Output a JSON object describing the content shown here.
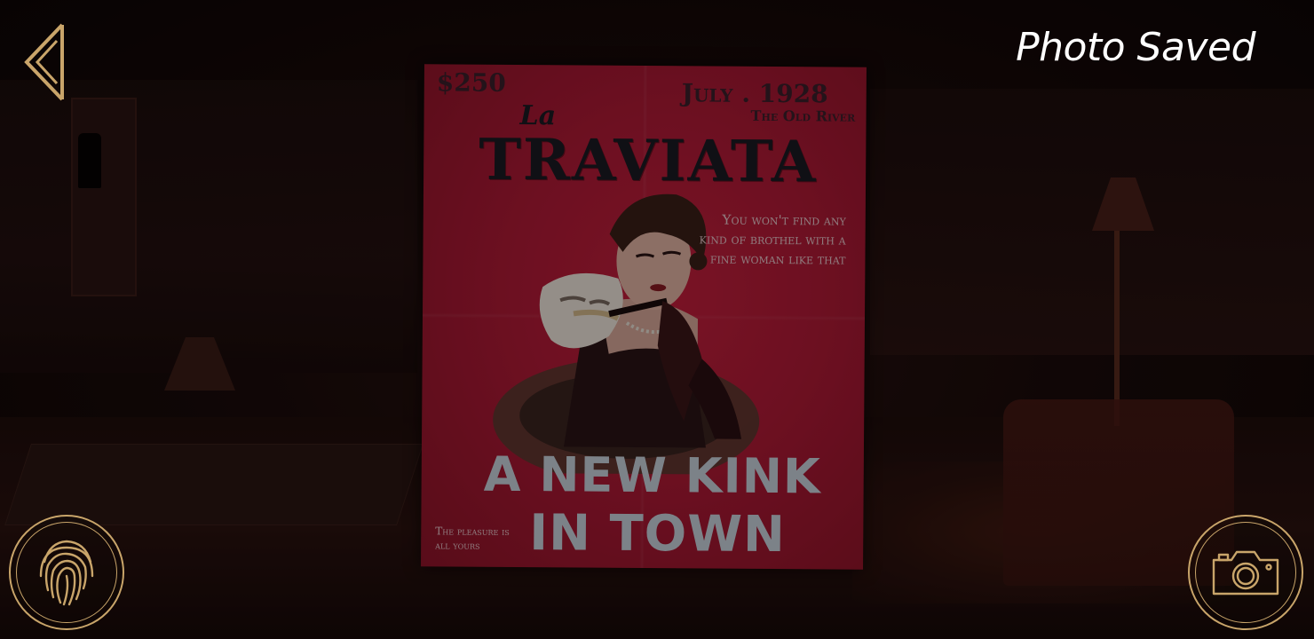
{
  "hud": {
    "status_message": "Photo Saved",
    "accent_color": "#c9a56a",
    "back_icon": "chevron-left-icon",
    "fingerprint_icon": "fingerprint-icon",
    "camera_icon": "camera-icon"
  },
  "poster": {
    "price": "$250",
    "date": "July . 1928",
    "venue": "The Old River",
    "title_prefix": "La",
    "title": "TRAVIATA",
    "tagline": "You won't find any kind of brothel with a fine woman like that",
    "headline_line1": "A NEW KINK",
    "headline_line2": "IN TOWN",
    "footer_note": "The pleasure is all yours",
    "background_color": "#b01a36"
  }
}
